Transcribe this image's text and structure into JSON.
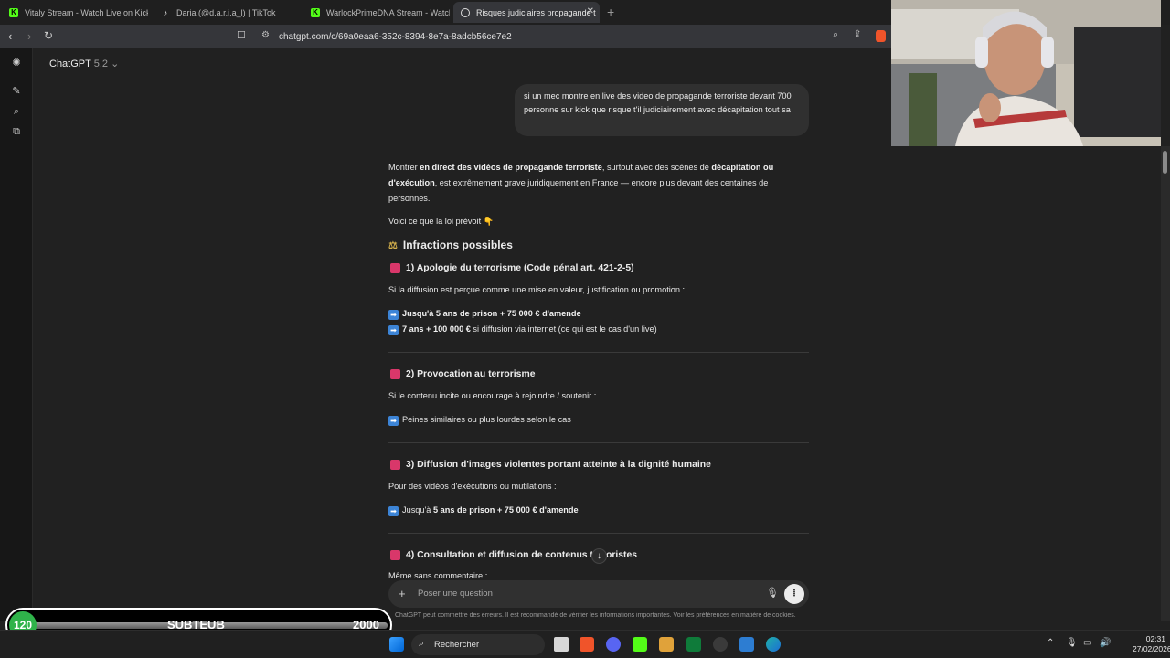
{
  "browser": {
    "tabs": [
      {
        "title": "Vitaly Stream - Watch Live on Kick",
        "icon": "kick-icon"
      },
      {
        "title": "Daria (@d.a.r.i.a_l) | TikTok",
        "icon": "tiktok-icon"
      },
      {
        "title": "WarlockPrimeDNA Stream - Watch Li",
        "icon": "kick-icon"
      },
      {
        "title": "Risques judiciaires propagande t",
        "icon": "chatgpt-icon",
        "active": true
      }
    ],
    "url": "chatgpt.com/c/69a0eaa6-352c-8394-8e7a-8adcb56ce7e2"
  },
  "chat": {
    "model_name": "ChatGPT",
    "model_version": "5.2",
    "user_message": "si un mec montre en live des video de propagande terroriste devant 700 personne sur kick que risque t'il judiciairement avec décapitation tout sa",
    "intro": {
      "t1": "Montrer ",
      "b1": "en direct des vidéos de propagande terroriste",
      "t2": ", surtout avec des scènes de ",
      "b2": "décapitation ou d'exécution",
      "t3": ", est extrêmement grave juridiquement en France — encore plus devant des centaines de personnes."
    },
    "law_intro": "Voici ce que la loi prévoit 👇",
    "section_title": "Infractions possibles",
    "s1": {
      "title": "1) Apologie du terrorisme (Code pénal art. 421-2-5)",
      "desc": "Si la diffusion est perçue comme une mise en valeur, justification ou promotion :",
      "line1_bold": "Jusqu'à 5 ans de prison + 75 000 € d'amende",
      "line2_bold": "7 ans + 100 000 €",
      "line2_rest": " si diffusion via internet (ce qui est le cas d'un live)"
    },
    "s2": {
      "title": "2) Provocation au terrorisme",
      "desc": "Si le contenu incite ou encourage à rejoindre / soutenir :",
      "line1": "Peines similaires ou plus lourdes selon le cas"
    },
    "s3": {
      "title": "3) Diffusion d'images violentes portant atteinte à la dignité humaine",
      "desc": "Pour des vidéos d'exécutions ou mutilations :",
      "line1_pre": "Jusqu'à ",
      "line1_bold": "5 ans de prison + 75 000 € d'amende"
    },
    "s4": {
      "title_a": "4) Consultation et diffusion de contenus t",
      "title_b": "roristes",
      "desc": "Même sans commentaire :"
    },
    "composer_placeholder": "Poser une question",
    "disclaimer": "ChatGPT peut commettre des erreurs. Il est recommandé de vérifier les informations importantes. Voir les préférences en matière de cookies."
  },
  "overlay": {
    "sub_count": "120",
    "sub_label": "SUBTEUB",
    "sub_goal": "2000",
    "sub_progress": 0.06
  },
  "taskbar": {
    "search_label": "Rechercher",
    "time": "02:31",
    "date": "27/02/2026"
  }
}
